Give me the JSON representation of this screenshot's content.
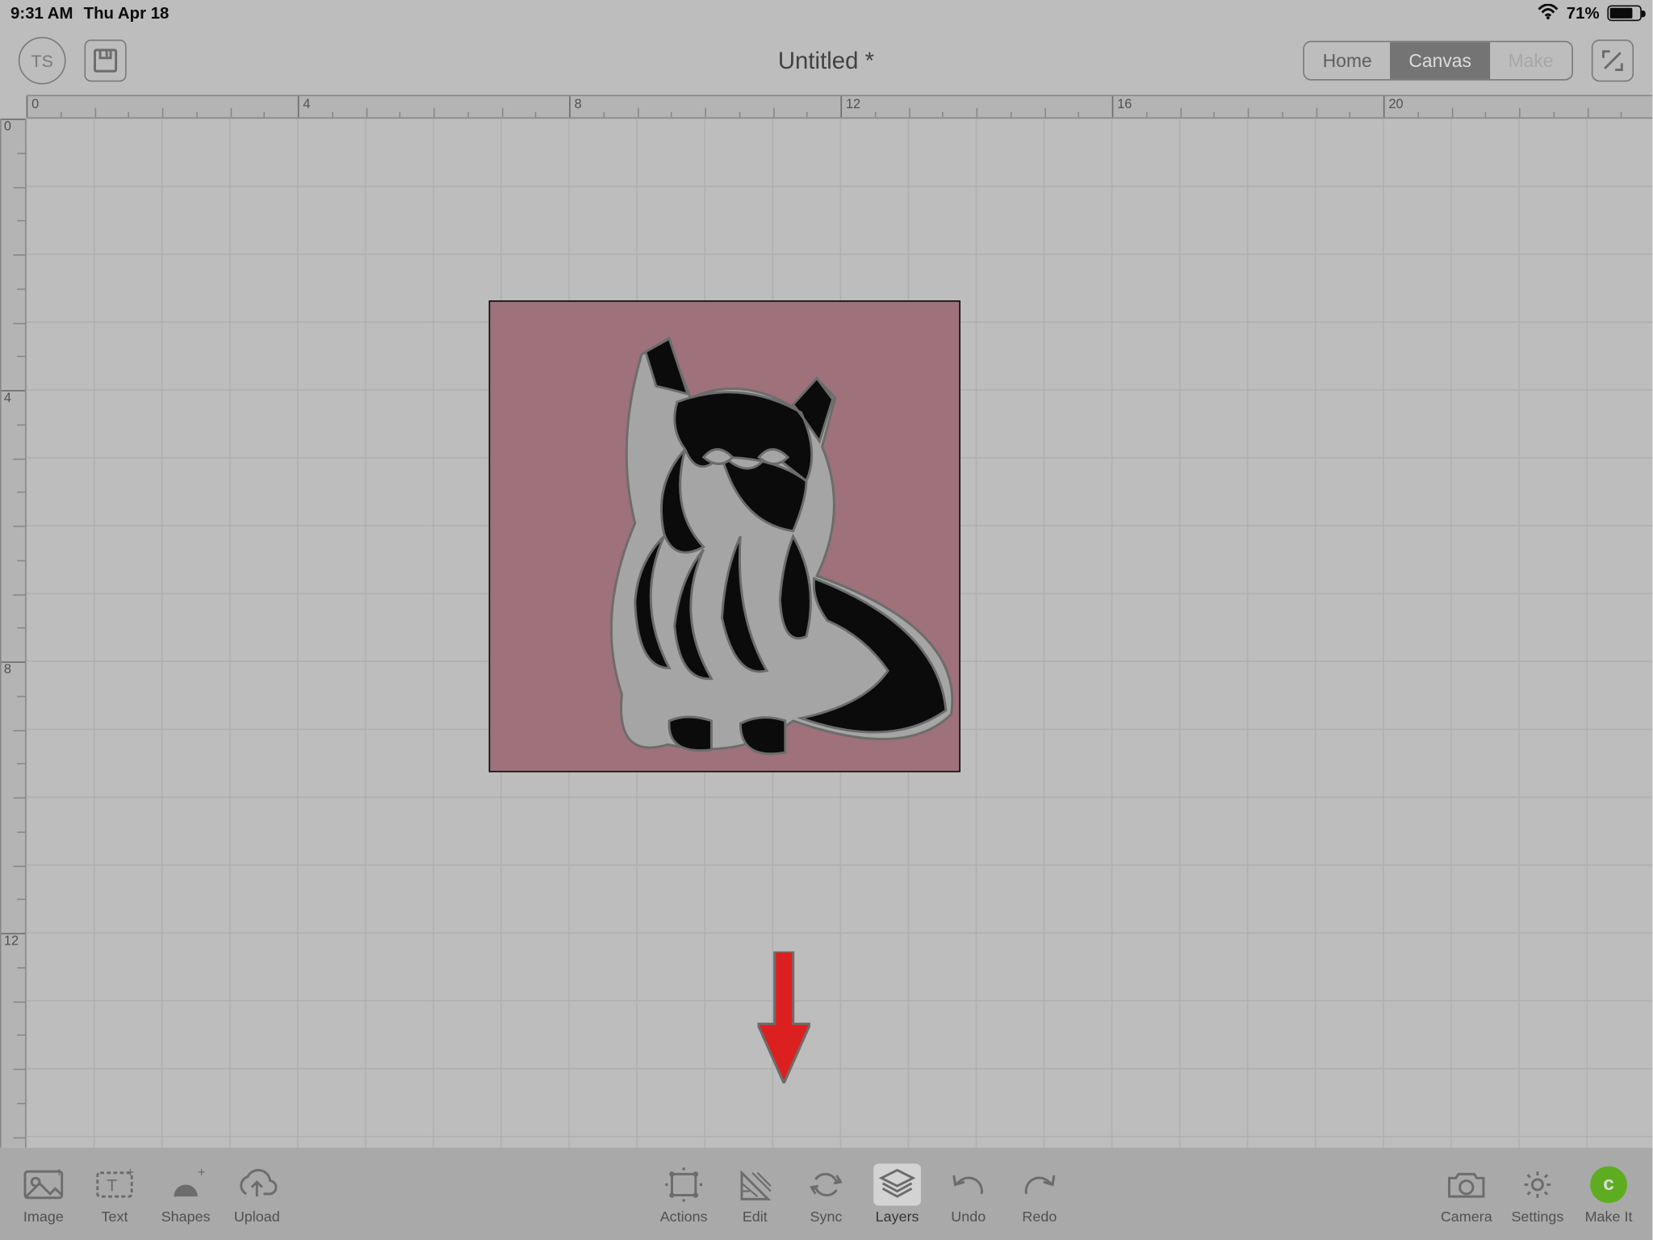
{
  "status": {
    "time": "9:31 AM",
    "date": "Thu Apr 18",
    "battery": "71%"
  },
  "header": {
    "avatar_initials": "TS",
    "title": "Untitled *",
    "tabs": {
      "home": "Home",
      "canvas": "Canvas",
      "make": "Make"
    }
  },
  "ruler_h": [
    "0",
    "4",
    "8",
    "12",
    "16",
    "20"
  ],
  "ruler_v": [
    "0",
    "4",
    "8",
    "12"
  ],
  "canvas": {
    "object": {
      "fill_hex": "#b47d89",
      "content": "cat-silhouette-illustration"
    }
  },
  "annotation": {
    "arrow_target": "layers-button"
  },
  "toolbar": {
    "left": [
      {
        "id": "image",
        "label": "Image"
      },
      {
        "id": "text",
        "label": "Text"
      },
      {
        "id": "shapes",
        "label": "Shapes"
      },
      {
        "id": "upload",
        "label": "Upload"
      }
    ],
    "mid": [
      {
        "id": "actions",
        "label": "Actions"
      },
      {
        "id": "edit",
        "label": "Edit"
      },
      {
        "id": "sync",
        "label": "Sync"
      },
      {
        "id": "layers",
        "label": "Layers",
        "selected": true
      },
      {
        "id": "undo",
        "label": "Undo"
      },
      {
        "id": "redo",
        "label": "Redo"
      }
    ],
    "right": [
      {
        "id": "camera",
        "label": "Camera"
      },
      {
        "id": "settings",
        "label": "Settings"
      },
      {
        "id": "makeit",
        "label": "Make It"
      }
    ]
  }
}
